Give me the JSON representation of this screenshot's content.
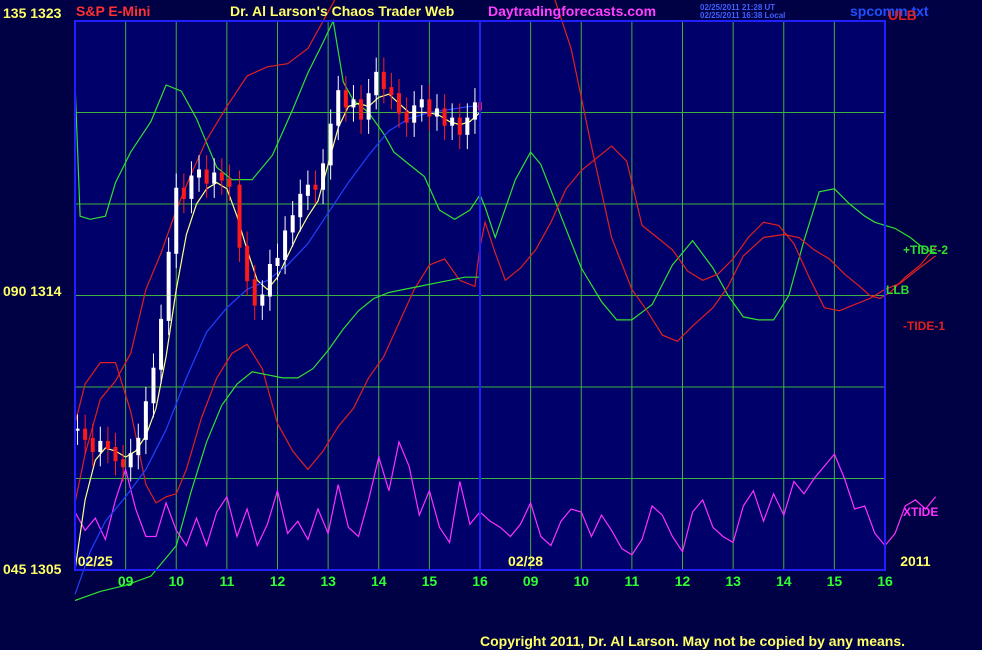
{
  "header": {
    "symbol": "S&P E-Mini",
    "title": "Dr. Al Larson's Chaos Trader Web",
    "site": "Daytradingforecasts.com",
    "timestamp_ut": "02/25/2011 21:28 UT",
    "timestamp_local": "02/25/2011 16:38 Local",
    "file": "spcomm.txt"
  },
  "footer": {
    "copyright": "Copyright 2011, Dr. Al Larson. May not be copied by any means."
  },
  "colors": {
    "background": "#000044",
    "plot_bg": "#00006a",
    "grid": "#40b040",
    "frame": "#2020ff",
    "price_up": "#ffffff",
    "price_down": "#ff1a1a",
    "moving_avg_fast": "#ffff80",
    "moving_avg_slow": "#2040ff",
    "tide_plus": "#30e030",
    "tide_minus": "#e02020",
    "xtide": "#ff30ff"
  },
  "chart_data": {
    "type": "line",
    "y_axis": {
      "left_labels": [
        {
          "osc": "135",
          "price": "1323"
        },
        {
          "osc": "090",
          "price": "1314"
        },
        {
          "osc": "045",
          "price": "1305"
        }
      ],
      "price_range": [
        1305,
        1323
      ]
    },
    "x_axis": {
      "dates": [
        {
          "label": "02/25",
          "at_hour": 8.4
        },
        {
          "label": "02/28",
          "at_hour": 16.9
        },
        {
          "label": "2011",
          "at_hour": 24.6
        }
      ],
      "hour_labels": [
        "09",
        "10",
        "11",
        "12",
        "13",
        "14",
        "15",
        "16",
        "09",
        "10",
        "11",
        "12",
        "13",
        "14",
        "15",
        "16"
      ]
    },
    "right_labels": [
      {
        "text": "ULB",
        "color": "#e02020"
      },
      {
        "text": "+TIDE-2",
        "color": "#30e030"
      },
      {
        "text": "LLB",
        "color": "#30e030"
      },
      {
        "text": "-TIDE-1",
        "color": "#e02020"
      },
      {
        "text": "XTIDE",
        "color": "#ff30ff"
      }
    ],
    "price_bars": {
      "description": "5-minute S&P E-Mini prices, 02/25 session",
      "points": [
        [
          8.05,
          1309.6
        ],
        [
          8.2,
          1309.3
        ],
        [
          8.35,
          1308.9
        ],
        [
          8.5,
          1309.2
        ],
        [
          8.65,
          1309.0
        ],
        [
          8.8,
          1308.6
        ],
        [
          8.95,
          1308.4
        ],
        [
          9.1,
          1308.8
        ],
        [
          9.25,
          1309.3
        ],
        [
          9.4,
          1310.5
        ],
        [
          9.55,
          1311.6
        ],
        [
          9.7,
          1313.2
        ],
        [
          9.85,
          1315.4
        ],
        [
          10.0,
          1317.5
        ],
        [
          10.15,
          1317.2
        ],
        [
          10.3,
          1317.9
        ],
        [
          10.45,
          1318.1
        ],
        [
          10.6,
          1317.7
        ],
        [
          10.75,
          1318.0
        ],
        [
          10.9,
          1317.8
        ],
        [
          11.05,
          1317.6
        ],
        [
          11.25,
          1315.6
        ],
        [
          11.4,
          1314.5
        ],
        [
          11.55,
          1313.7
        ],
        [
          11.7,
          1314.0
        ],
        [
          11.85,
          1315.0
        ],
        [
          12.0,
          1315.2
        ],
        [
          12.15,
          1316.1
        ],
        [
          12.3,
          1316.6
        ],
        [
          12.45,
          1317.3
        ],
        [
          12.6,
          1317.6
        ],
        [
          12.75,
          1317.5
        ],
        [
          12.9,
          1318.3
        ],
        [
          13.05,
          1319.6
        ],
        [
          13.2,
          1320.7
        ],
        [
          13.35,
          1320.2
        ],
        [
          13.5,
          1320.4
        ],
        [
          13.65,
          1319.8
        ],
        [
          13.8,
          1320.6
        ],
        [
          13.95,
          1321.3
        ],
        [
          14.1,
          1320.8
        ],
        [
          14.25,
          1320.6
        ],
        [
          14.4,
          1320.0
        ],
        [
          14.55,
          1319.7
        ],
        [
          14.7,
          1320.2
        ],
        [
          14.85,
          1320.4
        ],
        [
          15.0,
          1319.9
        ],
        [
          15.15,
          1320.1
        ],
        [
          15.3,
          1319.6
        ],
        [
          15.45,
          1319.8
        ],
        [
          15.6,
          1319.3
        ],
        [
          15.75,
          1319.8
        ],
        [
          15.9,
          1320.3
        ],
        [
          16.0,
          1320.1
        ]
      ]
    },
    "series": [
      {
        "name": "+TIDE-2",
        "color": "#30e030",
        "x": [
          8,
          8.1,
          8.3,
          8.6,
          8.8,
          9.1,
          9.5,
          9.8,
          10.1,
          10.4,
          10.8,
          11.1,
          11.5,
          11.9,
          12.3,
          12.6,
          12.9,
          13.1,
          13.3,
          13.5,
          13.8,
          14.1,
          14.3,
          14.6,
          14.9,
          15.2,
          15.5,
          15.8,
          16.0,
          16.1,
          16.3,
          16.7,
          17.0,
          17.2,
          17.6,
          18.0,
          18.4,
          18.7,
          19.0,
          19.4,
          19.8,
          20.2,
          20.6,
          20.9,
          21.2,
          21.5,
          21.8,
          22.1,
          22.4,
          22.7,
          23.0,
          23.3,
          23.6,
          23.8,
          24.0,
          24.2,
          24.5,
          24.8,
          25.0
        ],
        "y": [
          1321,
          1316.6,
          1316.5,
          1316.6,
          1317.7,
          1318.7,
          1319.7,
          1320.9,
          1320.7,
          1319.8,
          1318.2,
          1317.8,
          1317.8,
          1318.6,
          1320.1,
          1321.3,
          1322.3,
          1323.0,
          1321.0,
          1320.4,
          1320.0,
          1319.3,
          1318.7,
          1318.3,
          1317.9,
          1316.8,
          1316.5,
          1316.8,
          1317.3,
          1316.9,
          1315.9,
          1317.8,
          1318.7,
          1318.3,
          1316.6,
          1314.9,
          1313.8,
          1313.2,
          1313.2,
          1313.7,
          1315.0,
          1315.8,
          1314.9,
          1314.0,
          1313.3,
          1313.2,
          1313.2,
          1314.0,
          1315.8,
          1317.4,
          1317.5,
          1317.0,
          1316.6,
          1316.4,
          1316.3,
          1316.2,
          1315.9,
          1315.5,
          1315.4
        ]
      },
      {
        "name": "-TIDE-1",
        "color": "#e02020",
        "x": [
          8,
          8.2,
          8.5,
          8.8,
          9.1,
          9.4,
          9.7,
          10.0,
          10.3,
          10.6,
          11.0,
          11.4,
          11.8,
          12.2,
          12.6,
          13.0,
          13.3,
          13.6,
          13.9,
          14.2,
          14.5,
          14.8,
          15.1,
          15.4,
          15.7,
          16.0,
          16.3,
          16.6,
          17.0,
          17.4,
          17.8,
          18.2,
          18.6,
          19.0,
          19.3,
          19.6,
          19.9,
          20.2,
          20.6,
          20.9,
          21.2,
          21.6,
          22.0,
          22.3,
          22.6,
          22.9,
          23.2,
          23.5,
          23.7,
          23.9,
          24.1,
          24.4,
          24.7,
          25.0
        ],
        "y": [
          1307.2,
          1308.8,
          1310.6,
          1311.2,
          1312.1,
          1314.2,
          1315.4,
          1316.8,
          1318.0,
          1319.1,
          1320.2,
          1321.2,
          1321.5,
          1321.6,
          1322.1,
          1323.3,
          1324.2,
          1324.8,
          1325.3,
          1325.7,
          1325.9,
          1325.9,
          1326.0,
          1326.1,
          1326.2,
          1325.9,
          1325.7,
          1325.5,
          1325.1,
          1324.1,
          1322.1,
          1318.9,
          1315.9,
          1314.2,
          1313.5,
          1312.7,
          1312.5,
          1313.0,
          1313.6,
          1314.3,
          1315.3,
          1315.9,
          1316.0,
          1315.9,
          1315.5,
          1315.2,
          1314.7,
          1314.3,
          1314.0,
          1313.9,
          1314.1,
          1314.6,
          1315.0,
          1315.6
        ]
      },
      {
        "name": "ULB",
        "color": "#e02020",
        "x": [
          8,
          8.2,
          8.5,
          8.8,
          9.1,
          9.4,
          9.6,
          9.8,
          10.0,
          10.2,
          10.5,
          10.8,
          11.1,
          11.4,
          11.7,
          12.0,
          12.3,
          12.6,
          12.9,
          13.2,
          13.5,
          13.8,
          14.1,
          14.4,
          14.7,
          15.0,
          15.3,
          15.6,
          15.9,
          16.0,
          16.1,
          16.3,
          16.5,
          16.8,
          17.1,
          17.4,
          17.7,
          18.0,
          18.3,
          18.6,
          18.9,
          19.2,
          19.5,
          19.8,
          20.1,
          20.4,
          20.7,
          21.0,
          21.3,
          21.6,
          21.9,
          22.2,
          22.5,
          22.8,
          23.1,
          23.4,
          23.7,
          24.0,
          24.3,
          24.6,
          25.0
        ],
        "y": [
          1309.8,
          1311.1,
          1311.8,
          1311.8,
          1310.2,
          1307.8,
          1307.2,
          1307.4,
          1307.5,
          1308.3,
          1310.0,
          1311.3,
          1312.1,
          1312.4,
          1311.6,
          1309.8,
          1308.9,
          1308.3,
          1308.9,
          1309.7,
          1310.3,
          1311.3,
          1312.0,
          1313.1,
          1314.2,
          1315.0,
          1315.2,
          1314.5,
          1314.3,
          1315.6,
          1316.4,
          1315.4,
          1314.5,
          1314.9,
          1315.5,
          1316.4,
          1317.5,
          1318.1,
          1318.5,
          1318.9,
          1318.4,
          1316.3,
          1315.9,
          1315.5,
          1314.8,
          1314.5,
          1314.7,
          1315.2,
          1315.9,
          1316.4,
          1316.3,
          1315.7,
          1314.6,
          1313.6,
          1313.5,
          1313.7,
          1313.9,
          1314.2,
          1314.4,
          1314.8,
          1315.3
        ]
      },
      {
        "name": "LLB",
        "color": "#30e030",
        "x": [
          8,
          8.5,
          9.0,
          9.5,
          10.0,
          10.3,
          10.6,
          10.9,
          11.2,
          11.5,
          11.8,
          12.1,
          12.4,
          12.7,
          13.0,
          13.3,
          13.6,
          13.9,
          14.2,
          14.5,
          14.8,
          15.1,
          15.4,
          15.7,
          16.0
        ],
        "y": [
          1304.0,
          1304.3,
          1304.5,
          1304.8,
          1305.8,
          1307.6,
          1309.2,
          1310.4,
          1311.1,
          1311.5,
          1311.4,
          1311.3,
          1311.3,
          1311.6,
          1312.2,
          1312.9,
          1313.5,
          1313.9,
          1314.1,
          1314.2,
          1314.3,
          1314.4,
          1314.5,
          1314.6,
          1314.6
        ]
      },
      {
        "name": "XTIDE",
        "color": "#ff30ff",
        "x": [
          8,
          8.2,
          8.4,
          8.6,
          8.8,
          9.0,
          9.2,
          9.4,
          9.6,
          9.8,
          10.0,
          10.2,
          10.4,
          10.6,
          10.8,
          11.0,
          11.2,
          11.4,
          11.6,
          11.8,
          12.0,
          12.2,
          12.4,
          12.6,
          12.8,
          13.0,
          13.2,
          13.4,
          13.6,
          13.8,
          14.0,
          14.2,
          14.4,
          14.6,
          14.8,
          15.0,
          15.2,
          15.4,
          15.6,
          15.8,
          16.0,
          16.2,
          16.4,
          16.6,
          16.8,
          17.0,
          17.2,
          17.4,
          17.6,
          17.8,
          18.0,
          18.2,
          18.4,
          18.6,
          18.8,
          19.0,
          19.2,
          19.4,
          19.6,
          19.8,
          20.0,
          20.2,
          20.4,
          20.6,
          20.8,
          21.0,
          21.2,
          21.4,
          21.6,
          21.8,
          22.0,
          22.2,
          22.4,
          22.6,
          22.8,
          23.0,
          23.2,
          23.4,
          23.6,
          23.8,
          24.0,
          24.2,
          24.4,
          24.6,
          24.8,
          25.0
        ],
        "y": [
          1306.9,
          1306.3,
          1306.7,
          1306.0,
          1307.3,
          1308.3,
          1307.0,
          1306.1,
          1306.1,
          1307.2,
          1306.3,
          1305.8,
          1306.7,
          1305.8,
          1306.9,
          1307.4,
          1306.1,
          1307.0,
          1305.8,
          1306.5,
          1307.6,
          1306.2,
          1306.6,
          1306.0,
          1307.0,
          1306.2,
          1307.8,
          1306.4,
          1306.1,
          1307.3,
          1308.7,
          1307.6,
          1309.2,
          1308.4,
          1306.8,
          1307.6,
          1306.4,
          1305.9,
          1307.9,
          1306.5,
          1306.9,
          1306.6,
          1306.4,
          1306.1,
          1306.5,
          1307.2,
          1306.1,
          1305.8,
          1306.6,
          1307.0,
          1306.9,
          1306.1,
          1306.8,
          1306.3,
          1305.7,
          1305.5,
          1306.0,
          1307.1,
          1306.8,
          1306.1,
          1305.6,
          1306.9,
          1307.3,
          1306.4,
          1306.1,
          1305.9,
          1307.1,
          1307.6,
          1306.6,
          1307.5,
          1306.8,
          1307.9,
          1307.5,
          1308.0,
          1308.4,
          1308.8,
          1308.0,
          1307.0,
          1307.1,
          1306.2,
          1305.8,
          1306.2,
          1307.1,
          1307.3,
          1307.0,
          1307.4
        ]
      },
      {
        "name": "",
        "color": "#ffff80",
        "x": [
          8.0,
          8.2,
          8.4,
          8.6,
          8.8,
          9.0,
          9.2,
          9.4,
          9.6,
          9.8,
          10.0,
          10.2,
          10.4,
          10.6,
          10.8,
          11.0,
          11.2,
          11.4,
          11.6,
          11.8,
          12.0,
          12.2,
          12.4,
          12.6,
          12.8,
          13.0,
          13.2,
          13.4,
          13.6,
          13.8,
          14.0,
          14.2,
          14.4,
          14.6,
          14.8,
          15.0,
          15.2,
          15.4,
          15.6,
          15.8,
          16.0
        ],
        "y": [
          1305.0,
          1307.3,
          1308.6,
          1309.0,
          1308.9,
          1308.7,
          1308.9,
          1309.4,
          1310.3,
          1312.0,
          1314.2,
          1316.0,
          1317.0,
          1317.5,
          1317.7,
          1317.5,
          1316.6,
          1315.5,
          1314.5,
          1314.2,
          1314.6,
          1315.3,
          1316.0,
          1316.6,
          1317.1,
          1318.3,
          1319.5,
          1320.2,
          1320.3,
          1320.2,
          1320.5,
          1320.6,
          1320.3,
          1320.0,
          1320.0,
          1320.0,
          1319.9,
          1319.7,
          1319.6,
          1319.7,
          1320.0
        ]
      },
      {
        "name": "",
        "color": "#2040ff",
        "x": [
          8.0,
          8.3,
          8.6,
          9.0,
          9.4,
          9.8,
          10.2,
          10.6,
          11.0,
          11.4,
          11.8,
          12.2,
          12.6,
          13.0,
          13.4,
          13.8,
          14.2,
          14.6,
          15.0,
          15.4,
          15.8,
          16.0
        ],
        "y": [
          1304.2,
          1305.6,
          1306.6,
          1307.4,
          1308.3,
          1309.6,
          1311.3,
          1312.8,
          1313.6,
          1314.2,
          1314.5,
          1315.0,
          1315.7,
          1316.7,
          1317.7,
          1318.6,
          1319.4,
          1319.8,
          1320.0,
          1320.1,
          1320.2,
          1320.2
        ]
      }
    ],
    "grid": true
  }
}
